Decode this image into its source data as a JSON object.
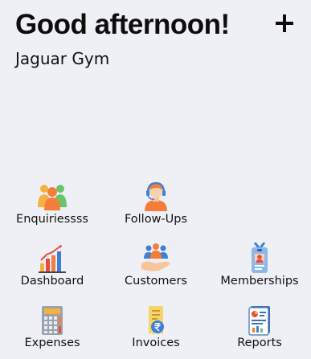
{
  "header": {
    "greeting": "Good afternoon!",
    "gym_name": "Jaguar Gym",
    "add_icon": "plus-icon"
  },
  "tiles": [
    {
      "label": "Enquiriessss",
      "icon": "people-group-icon"
    },
    {
      "label": "Follow-Ups",
      "icon": "headset-agent-icon"
    },
    {
      "label": "Dashboard",
      "icon": "bar-chart-icon"
    },
    {
      "label": "Customers",
      "icon": "customers-hand-icon"
    },
    {
      "label": "Memberships",
      "icon": "id-badge-icon"
    },
    {
      "label": "Expenses",
      "icon": "calculator-icon"
    },
    {
      "label": "Invoices",
      "icon": "rupee-bill-icon"
    },
    {
      "label": "Reports",
      "icon": "report-document-icon"
    }
  ],
  "colors": {
    "background": "#eef0f6",
    "text": "#111111",
    "accent_orange": "#f47d3a",
    "accent_blue": "#3f7fd8",
    "accent_green": "#6cc36b"
  }
}
